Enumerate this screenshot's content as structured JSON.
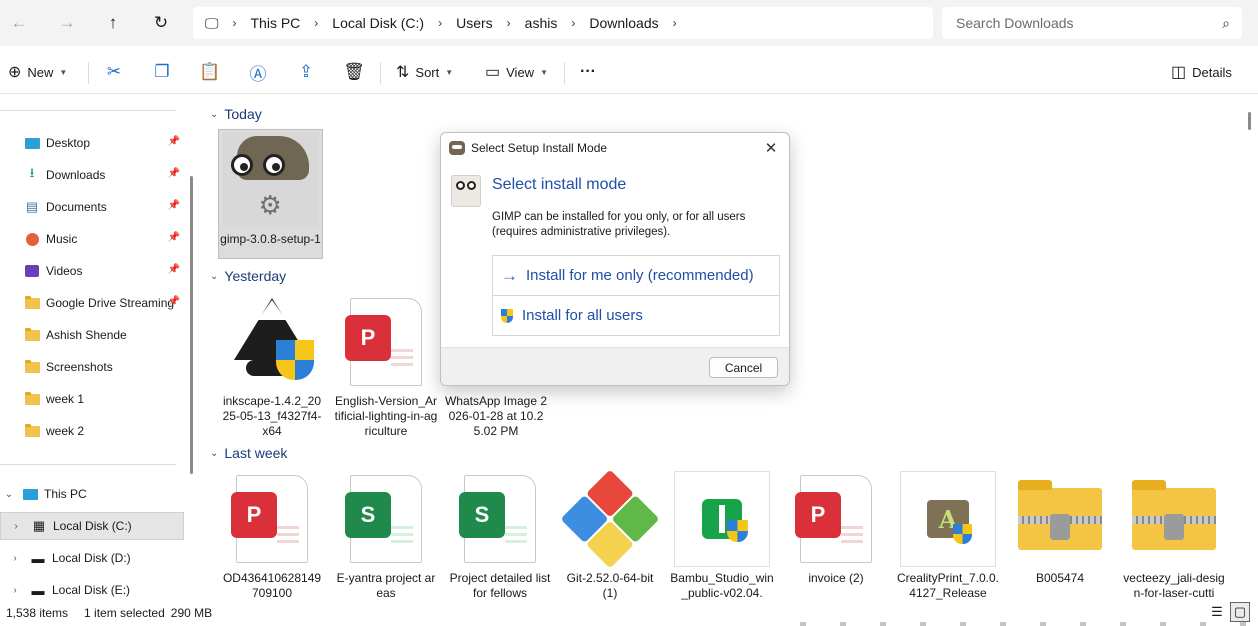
{
  "nav": {
    "back": "←",
    "forward": "→",
    "up": "↑",
    "refresh": "↻"
  },
  "breadcrumb": {
    "items": [
      "This PC",
      "Local Disk (C:)",
      "Users",
      "ashis",
      "Downloads"
    ],
    "sep": "›"
  },
  "search": {
    "placeholder": "Search Downloads"
  },
  "toolbar": {
    "new_label": "New",
    "sort_label": "Sort",
    "view_label": "View",
    "more_label": "···",
    "details_label": "Details"
  },
  "sidebar": {
    "quick_access": [
      {
        "label": "Desktop",
        "icon": "desktop-icon"
      },
      {
        "label": "Downloads",
        "icon": "download-icon"
      },
      {
        "label": "Documents",
        "icon": "document-icon"
      },
      {
        "label": "Music",
        "icon": "music-icon"
      },
      {
        "label": "Videos",
        "icon": "video-icon"
      },
      {
        "label": "Google Drive Streaming",
        "icon": "folder-icon"
      },
      {
        "label": "Ashish Shende",
        "icon": "folder-icon"
      },
      {
        "label": "Screenshots",
        "icon": "folder-icon"
      },
      {
        "label": "week 1",
        "icon": "folder-icon"
      },
      {
        "label": "week 2",
        "icon": "folder-icon"
      }
    ],
    "this_pc": "This PC",
    "drives": [
      "Local Disk (C:)",
      "Local Disk (D:)",
      "Local Disk (E:)"
    ]
  },
  "groups": {
    "today": "Today",
    "yesterday": "Yesterday",
    "last_week": "Last week"
  },
  "files": {
    "today": [
      {
        "name": "gimp-3.0.8-setup-1"
      }
    ],
    "yesterday": [
      {
        "name": "inkscape-1.4.2_2025-05-13_f4327f4-x64"
      },
      {
        "name": "English-Version_Artificial-lighting-in-agriculture"
      },
      {
        "name": "WhatsApp Image 2026-01-28 at 10.25.02 PM"
      }
    ],
    "last_week": [
      {
        "name": "OD436410628149709100"
      },
      {
        "name": "E-yantra project areas"
      },
      {
        "name": "Project detailed list for fellows"
      },
      {
        "name": "Git-2.52.0-64-bit (1)"
      },
      {
        "name": "Bambu_Studio_win_public-v02.04."
      },
      {
        "name": "invoice (2)"
      },
      {
        "name": "CrealityPrint_7.0.0.4127_Release"
      },
      {
        "name": "B005474"
      },
      {
        "name": "vecteezy_jali-design-for-laser-cutti"
      }
    ]
  },
  "status": {
    "items": "1,538 items",
    "selected": "1 item selected",
    "size": "290 MB"
  },
  "dialog": {
    "title": "Select Setup Install Mode",
    "heading": "Select install mode",
    "description": "GIMP can be installed for you only, or for all users (requires administrative privileges).",
    "option_me": "Install for me only (recommended)",
    "option_all": "Install for all users",
    "cancel": "Cancel"
  },
  "colors": {
    "accent": "#1f4fa8",
    "pdf_red": "#d9303a",
    "sheet_green": "#1f8a4c",
    "folder_yellow": "#f2c14e"
  }
}
